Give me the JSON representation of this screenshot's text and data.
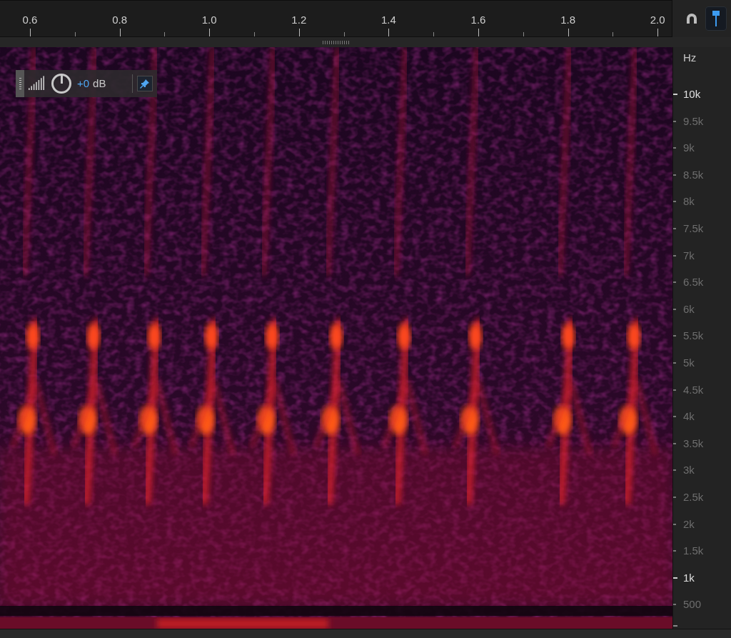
{
  "ruler": {
    "labels": [
      "0.6",
      "0.8",
      "1.0",
      "1.2",
      "1.4",
      "1.6",
      "1.8",
      "2.0"
    ]
  },
  "tools": [
    {
      "kind": "magnet",
      "selected": false
    },
    {
      "kind": "marker",
      "selected": true
    }
  ],
  "hud": {
    "gain_value": "+0",
    "gain_unit": "dB",
    "pinned": true
  },
  "frequency_axis": {
    "unit": "Hz",
    "labels": [
      {
        "text": "10k",
        "emphasized": true
      },
      {
        "text": "9.5k",
        "emphasized": false
      },
      {
        "text": "9k",
        "emphasized": false
      },
      {
        "text": "8.5k",
        "emphasized": false
      },
      {
        "text": "8k",
        "emphasized": false
      },
      {
        "text": "7.5k",
        "emphasized": false
      },
      {
        "text": "7k",
        "emphasized": false
      },
      {
        "text": "6.5k",
        "emphasized": false
      },
      {
        "text": "6k",
        "emphasized": false
      },
      {
        "text": "5.5k",
        "emphasized": false
      },
      {
        "text": "5k",
        "emphasized": false
      },
      {
        "text": "4.5k",
        "emphasized": false
      },
      {
        "text": "4k",
        "emphasized": false
      },
      {
        "text": "3.5k",
        "emphasized": false
      },
      {
        "text": "3k",
        "emphasized": false
      },
      {
        "text": "2.5k",
        "emphasized": false
      },
      {
        "text": "2k",
        "emphasized": false
      },
      {
        "text": "1.5k",
        "emphasized": false
      },
      {
        "text": "1k",
        "emphasized": true
      },
      {
        "text": "500",
        "emphasized": false
      }
    ]
  }
}
